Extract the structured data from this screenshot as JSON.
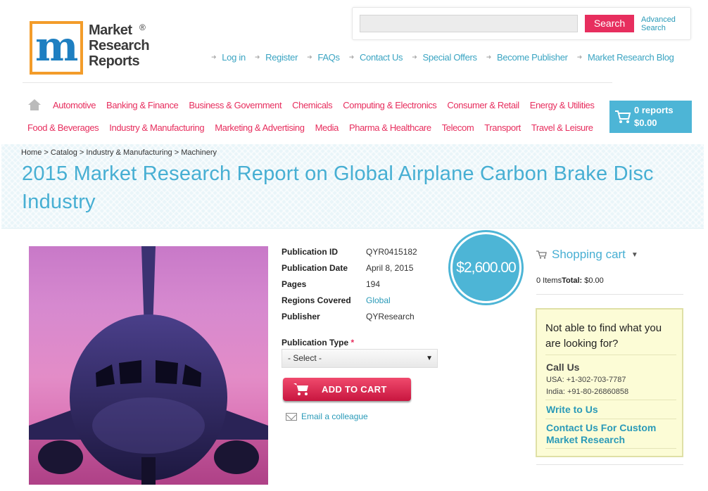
{
  "logo": {
    "line1": "Market",
    "line2": "Research",
    "line3": "Reports",
    "reg": "®",
    "colors": {
      "m1": "#1e7fc1",
      "m2": "#6cb33e",
      "m3": "#9b2b8b",
      "frame": "#f39c2a"
    }
  },
  "search": {
    "placeholder": "",
    "button": "Search",
    "advanced_line1": "Advanced",
    "advanced_line2": "Search"
  },
  "top_links": [
    "Log in",
    "Register",
    "FAQs",
    "Contact Us",
    "Special Offers",
    "Become Publisher",
    "Market Research Blog"
  ],
  "categories_row1": [
    "Automotive",
    "Banking & Finance",
    "Business & Government",
    "Chemicals",
    "Computing & Electronics",
    "Consumer & Retail",
    "Energy & Utilities"
  ],
  "categories_row2": [
    "Food & Beverages",
    "Industry & Manufacturing",
    "Marketing & Advertising",
    "Media",
    "Pharma & Healthcare",
    "Telecom",
    "Transport",
    "Travel & Leisure"
  ],
  "header_cart": {
    "reports": "0 reports",
    "total": "$0.00"
  },
  "breadcrumb": [
    "Home",
    "Catalog",
    "Industry & Manufacturing",
    "Machinery"
  ],
  "breadcrumb_sep": ">",
  "title": "2015 Market Research Report on Global Airplane Carbon Brake Disc Industry",
  "details": [
    {
      "label": "Publication ID",
      "value": "QYR0415182"
    },
    {
      "label": "Publication Date",
      "value": "April 8, 2015"
    },
    {
      "label": "Pages",
      "value": "194"
    },
    {
      "label": "Regions Covered",
      "value": "Global"
    },
    {
      "label": "Publisher",
      "value": "QYResearch"
    }
  ],
  "price": "$2,600.00",
  "publication_type": {
    "label": "Publication Type",
    "required_mark": "*",
    "selected": "- Select -"
  },
  "add_to_cart": "ADD TO CART",
  "email_colleague": "Email a colleague",
  "shopping_cart": {
    "heading": "Shopping cart",
    "items": "0 Items",
    "total_label": "Total:",
    "total_value": "$0.00"
  },
  "help_box": {
    "question": "Not able to find what you are looking for?",
    "call_us": "Call Us",
    "usa": "USA: +1-302-703-7787",
    "india": "India: +91-80-26860858",
    "write_to_us": "Write to Us",
    "custom_research": "Contact Us For Custom Market Research"
  },
  "colors": {
    "accent_blue": "#47afd3",
    "accent_pink": "#e72e5e",
    "cart_blue": "#4db5d6",
    "help_bg": "#fcfcd6"
  }
}
